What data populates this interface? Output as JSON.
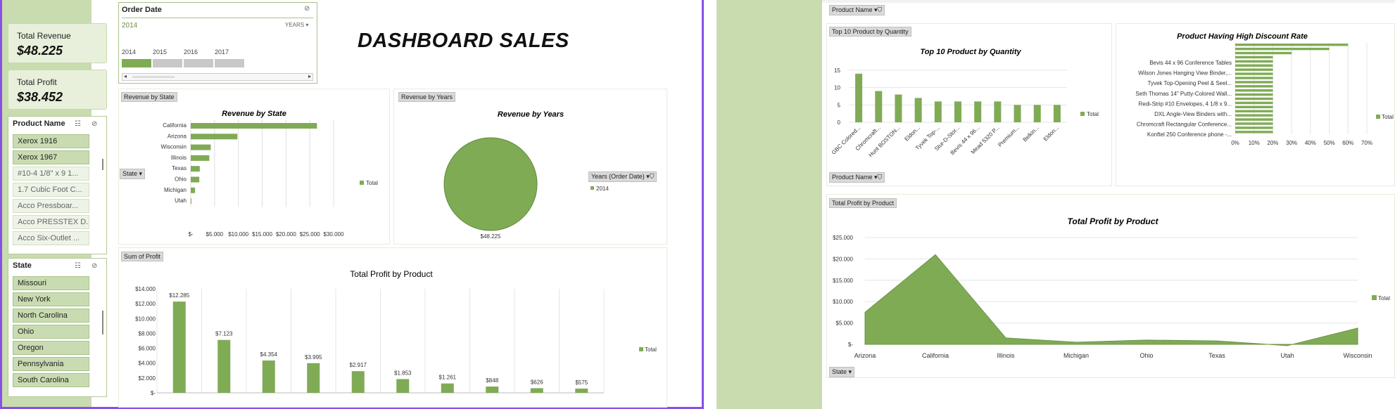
{
  "dashboard": {
    "title": "DASHBOARD SALES"
  },
  "kpis": {
    "revenue_label": "Total Revenue",
    "revenue_value": "$48.225",
    "profit_label": "Total Profit",
    "profit_value": "$38.452"
  },
  "timeline": {
    "title": "Order Date",
    "selected": "2014",
    "granularity": "YEARS",
    "years": [
      "2014",
      "2015",
      "2016",
      "2017"
    ]
  },
  "product_slicer": {
    "title": "Product Name",
    "items": [
      {
        "label": "Xerox 1916",
        "selected": true
      },
      {
        "label": "Xerox 1967",
        "selected": true
      },
      {
        "label": "#10-4 1/8\" x 9 1...",
        "selected": false
      },
      {
        "label": "1.7 Cubic Foot C...",
        "selected": false
      },
      {
        "label": "Acco Pressboar...",
        "selected": false
      },
      {
        "label": "Acco PRESSTEX D...",
        "selected": false
      },
      {
        "label": "Acco Six-Outlet ...",
        "selected": false
      }
    ]
  },
  "state_slicer": {
    "title": "State",
    "items": [
      "Missouri",
      "New York",
      "North Carolina",
      "Ohio",
      "Oregon",
      "Pennsylvania",
      "South Carolina"
    ]
  },
  "tags": {
    "revenue_by_state": "Revenue by State",
    "revenue_by_years": "Revenue by Years",
    "sum_of_profit": "Sum of Profit",
    "state_filter": "State",
    "years_filter": "Years (Order Date)",
    "product_name_top": "Product Name",
    "top10": "Top 10 Product by Quantity",
    "product_name_mid": "Product Name",
    "total_profit_by_product": "Total Profit by Product",
    "state_bottom": "State"
  },
  "colors": {
    "accent": "#7fab55",
    "frame": "#8a4fe6",
    "sidebar": "#c8dcb0"
  },
  "chart_data": [
    {
      "type": "bar",
      "orientation": "horizontal",
      "title": "Revenue by State",
      "categories": [
        "California",
        "Arizona",
        "Wisconsin",
        "Illinois",
        "Texas",
        "Ohio",
        "Michigan",
        "Utah"
      ],
      "values": [
        26500,
        9800,
        4200,
        3900,
        1900,
        1800,
        900,
        150
      ],
      "xticks": [
        "$-",
        "$5.000",
        "$10.000",
        "$15.000",
        "$20.000",
        "$25.000",
        "$30.000"
      ],
      "xlim": [
        0,
        30000
      ],
      "legend": "Total"
    },
    {
      "type": "pie",
      "title": "Revenue by Years",
      "categories": [
        "2014"
      ],
      "values": [
        48225
      ],
      "value_labels": [
        "$48.225"
      ],
      "legend": "2014"
    },
    {
      "type": "bar",
      "title": "Total Profit by Product",
      "values": [
        12285,
        7123,
        4354,
        3995,
        2917,
        1853,
        1261,
        848,
        626,
        575
      ],
      "value_labels": [
        "$12.285",
        "$7.123",
        "$4.354",
        "$3.995",
        "$2.917",
        "$1.853",
        "$1.261",
        "$848",
        "$626",
        "$575"
      ],
      "yticks": [
        "$-",
        "$2.000",
        "$4.000",
        "$6.000",
        "$8.000",
        "$10.000",
        "$12.000",
        "$14.000"
      ],
      "ylim": [
        0,
        14000
      ],
      "legend": "Total"
    },
    {
      "type": "bar",
      "title": "Top 10 Product by Quantity",
      "categories": [
        "GBC Colored...",
        "Chromcraft...",
        "Hunt BOSTON...",
        "Eldon...",
        "Tyvek Top-...",
        "Stur-D-Stor...",
        "Bevis 44 x 96...",
        "Mead 5320 P...",
        "Premium...",
        "Belkin...",
        "Eldon..."
      ],
      "values": [
        14,
        9,
        8,
        7,
        6,
        6,
        6,
        6,
        5,
        5,
        5
      ],
      "yticks": [
        "0",
        "5",
        "10",
        "15"
      ],
      "ylim": [
        0,
        16
      ],
      "legend": "Total"
    },
    {
      "type": "bar",
      "orientation": "horizontal",
      "title": "Product Having High Discount Rate",
      "categories": [
        "Bevis 44 x 96 Conference Tables",
        "Wilson Jones Hanging View Binder,...",
        "Tyvek Top-Opening Peel & Seel...",
        "Seth Thomas 14\" Putty-Colored Wall...",
        "Redi-Strip #10 Envelopes, 4 1/8 x 9...",
        "DXL Angle-View Binders with...",
        "Chromcraft Rectangular Conference...",
        "Konftel 250 Conference phone -..."
      ],
      "values": [
        0.6,
        0.5,
        0.3,
        0.2,
        0.2,
        0.2,
        0.2,
        0.2,
        0.2,
        0.2,
        0.2,
        0.2,
        0.2,
        0.2,
        0.2,
        0.2,
        0.2,
        0.2,
        0.2,
        0.2,
        0.2,
        0.2
      ],
      "xticks": [
        "0%",
        "10%",
        "20%",
        "30%",
        "40%",
        "50%",
        "60%",
        "70%"
      ],
      "xlim": [
        0,
        0.7
      ],
      "legend": "Total"
    },
    {
      "type": "area",
      "title": "Total Profit by Product",
      "categories": [
        "Arizona",
        "California",
        "Illinois",
        "Michigan",
        "Ohio",
        "Texas",
        "Utah",
        "Wisconsin"
      ],
      "values": [
        7500,
        21000,
        1500,
        500,
        1000,
        800,
        -300,
        3800
      ],
      "yticks": [
        "$-",
        "$5.000",
        "$10.000",
        "$15.000",
        "$20.000",
        "$25.000"
      ],
      "ylim": [
        0,
        25000
      ],
      "legend": "Total"
    }
  ]
}
